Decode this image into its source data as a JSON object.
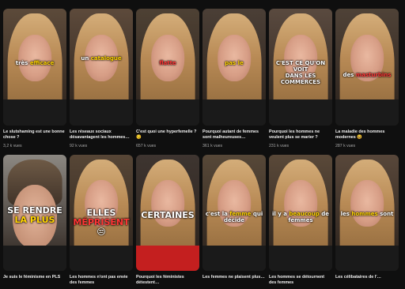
{
  "shorts": [
    {
      "title": "Le slutshaming est une bonne chose ?",
      "views": "3,2 k vues",
      "caption_pre": "très ",
      "caption_hl": "efficace",
      "caption_post": "",
      "hl": "yellow",
      "bg": "#5c4a3a"
    },
    {
      "title": "Les réseaux sociaux désavantagent les hommes…",
      "views": "92 k vues",
      "caption_pre": "un ",
      "caption_hl": "catalogue",
      "caption_post": "",
      "hl": "yellow",
      "bg": "#5d4a3b"
    },
    {
      "title": "C'est quoi une hyperfemelle ? 😏",
      "views": "657 k vues",
      "caption_pre": "",
      "caption_hl": "flatte",
      "caption_post": "",
      "hl": "red",
      "bg": "#4e4134"
    },
    {
      "title": "Pourquoi autant de femmes sont malheureuses…",
      "views": "361 k vues",
      "caption_pre": "",
      "caption_hl": "pas le",
      "caption_post": "",
      "hl": "yellow",
      "bg": "#4b3f36"
    },
    {
      "title": "Pourquoi les hommes ne veulent plus se marier ?",
      "views": "231 k vues",
      "caption_pre": "C'EST CE QU'ON VOIT\nDANS LES COMMERCES",
      "caption_hl": "",
      "caption_post": "",
      "hl": "yellow",
      "bg": "#5a4a3f"
    },
    {
      "title": "La maladie des hommes modernes 😆",
      "views": "287 k vues",
      "caption_pre": "des ",
      "caption_hl": "masturbins",
      "caption_post": "",
      "hl": "red",
      "bg": "#4f4237"
    },
    {
      "title": "Je suis le féminisme en PLS",
      "views": "",
      "caption_pre": "SE RENDRE ",
      "caption_hl": "LA PLUS",
      "caption_post": "",
      "hl": "yellow",
      "bg": "#8c8882"
    },
    {
      "title": "Les hommes n'ont pas envie des femmes",
      "views": "",
      "caption_pre": "ELLES ",
      "caption_hl": "MÉPRISENT",
      "caption_post": "\n😒",
      "hl": "red",
      "bg": "#574636"
    },
    {
      "title": "Pourquoi les féministes détestent…",
      "views": "",
      "caption_pre": "CERTAINES",
      "caption_hl": "",
      "caption_post": "",
      "hl": "yellow",
      "bg": "#3e3530"
    },
    {
      "title": "Les femmes ne plaisent plus…",
      "views": "",
      "caption_pre": "c'est la ",
      "caption_hl": "femme",
      "caption_post": " qui décide",
      "hl": "yellow",
      "bg": "#574838"
    },
    {
      "title": "Les hommes se détournent des femmes",
      "views": "",
      "caption_pre": "il y a ",
      "caption_hl": "beaucoup",
      "caption_post": " de femmes",
      "hl": "yellow",
      "bg": "#5a4939"
    },
    {
      "title": "Les célibataires de l'…",
      "views": "",
      "caption_pre": "les ",
      "caption_hl": "hommes",
      "caption_post": " sont",
      "hl": "yellow",
      "bg": "#58473a"
    }
  ]
}
